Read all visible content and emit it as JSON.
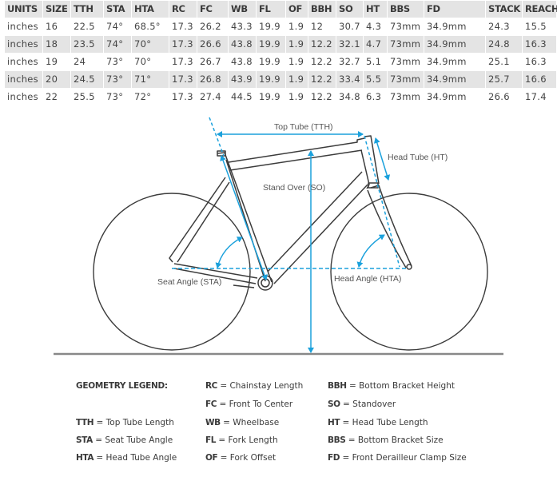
{
  "table": {
    "headers": [
      "UNITS",
      "SIZE",
      "TTH",
      "STA",
      "HTA",
      "RC",
      "FC",
      "WB",
      "FL",
      "OF",
      "BBH",
      "SO",
      "HT",
      "BBS",
      "FD",
      "STACK",
      "REACH"
    ],
    "rows": [
      [
        "inches",
        "16",
        "22.5",
        "74°",
        "68.5°",
        "17.3",
        "26.2",
        "43.3",
        "19.9",
        "1.9",
        "12",
        "30.7",
        "4.3",
        "73mm",
        "34.9mm",
        "24.3",
        "15.5"
      ],
      [
        "inches",
        "18",
        "23.5",
        "74°",
        "70°",
        "17.3",
        "26.6",
        "43.8",
        "19.9",
        "1.9",
        "12.2",
        "32.1",
        "4.7",
        "73mm",
        "34.9mm",
        "24.8",
        "16.3"
      ],
      [
        "inches",
        "19",
        "24",
        "73°",
        "70°",
        "17.3",
        "26.7",
        "43.8",
        "19.9",
        "1.9",
        "12.2",
        "32.7",
        "5.1",
        "73mm",
        "34.9mm",
        "25.1",
        "16.3"
      ],
      [
        "inches",
        "20",
        "24.5",
        "73°",
        "71°",
        "17.3",
        "26.8",
        "43.9",
        "19.9",
        "1.9",
        "12.2",
        "33.4",
        "5.5",
        "73mm",
        "34.9mm",
        "25.7",
        "16.6"
      ],
      [
        "inches",
        "22",
        "25.5",
        "73°",
        "72°",
        "17.3",
        "27.4",
        "44.5",
        "19.9",
        "1.9",
        "12.2",
        "34.8",
        "6.3",
        "73mm",
        "34.9mm",
        "26.6",
        "17.4"
      ]
    ]
  },
  "diagram": {
    "labels": {
      "top_tube": "Top Tube (TTH)",
      "head_tube": "Head Tube (HT)",
      "stand_over": "Stand Over (SO)",
      "seat_angle": "Seat Angle (STA)",
      "head_angle": "Head Angle (HTA)"
    },
    "colors": {
      "frame": "#3c3c3c",
      "dimension": "#1ba1dc",
      "ground": "#888888"
    }
  },
  "legend": {
    "title": "GEOMETRY LEGEND:",
    "items": [
      {
        "abbr": "TTH",
        "desc": "= Top Tube Length"
      },
      {
        "abbr": "STA",
        "desc": "= Seat Tube Angle"
      },
      {
        "abbr": "HTA",
        "desc": "= Head Tube Angle"
      },
      {
        "abbr": "RC",
        "desc": "= Chainstay Length"
      },
      {
        "abbr": "FC",
        "desc": "= Front To Center"
      },
      {
        "abbr": "WB",
        "desc": "= Wheelbase"
      },
      {
        "abbr": "FL",
        "desc": "= Fork Length"
      },
      {
        "abbr": "OF",
        "desc": "= Fork Offset"
      },
      {
        "abbr": "BBH",
        "desc": "= Bottom Bracket Height"
      },
      {
        "abbr": "SO",
        "desc": "= Standover"
      },
      {
        "abbr": "HT",
        "desc": "= Head Tube Length"
      },
      {
        "abbr": "BBS",
        "desc": "= Bottom Bracket Size"
      },
      {
        "abbr": "FD",
        "desc": "= Front Derailleur Clamp Size"
      }
    ]
  }
}
